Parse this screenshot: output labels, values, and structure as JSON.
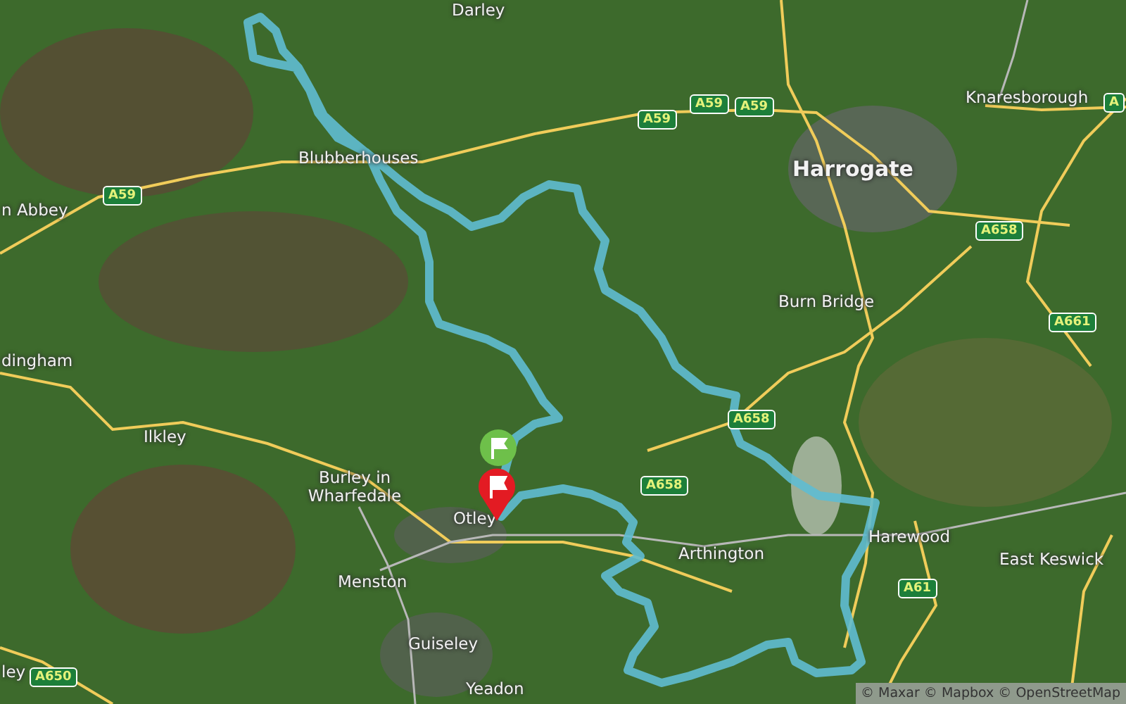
{
  "map": {
    "place_labels": [
      {
        "text": "Darley",
        "kind": "village"
      },
      {
        "text": "Blubberhouses",
        "kind": "village"
      },
      {
        "text": "n Abbey",
        "kind": "village"
      },
      {
        "text": "Harrogate",
        "kind": "town"
      },
      {
        "text": "Knaresborough",
        "kind": "village"
      },
      {
        "text": "Burn Bridge",
        "kind": "village"
      },
      {
        "text": "dingham",
        "kind": "village"
      },
      {
        "text": "Ilkley",
        "kind": "village"
      },
      {
        "text": "Burley in Wharfedale",
        "kind": "village"
      },
      {
        "text": "Otley",
        "kind": "village"
      },
      {
        "text": "Menston",
        "kind": "village"
      },
      {
        "text": "Guiseley",
        "kind": "village"
      },
      {
        "text": "Yeadon",
        "kind": "village"
      },
      {
        "text": "Arthington",
        "kind": "village"
      },
      {
        "text": "Harewood",
        "kind": "village"
      },
      {
        "text": "East Keswick",
        "kind": "village"
      },
      {
        "text": "ley",
        "kind": "village"
      }
    ],
    "road_shields": [
      "A59",
      "A59",
      "A59",
      "A59",
      "A",
      "A658",
      "A661",
      "A658",
      "A658",
      "A61",
      "A650"
    ],
    "markers": [
      {
        "kind": "start"
      },
      {
        "kind": "finish"
      }
    ],
    "attribution": "© Maxar © Mapbox © OpenStreetMap"
  }
}
